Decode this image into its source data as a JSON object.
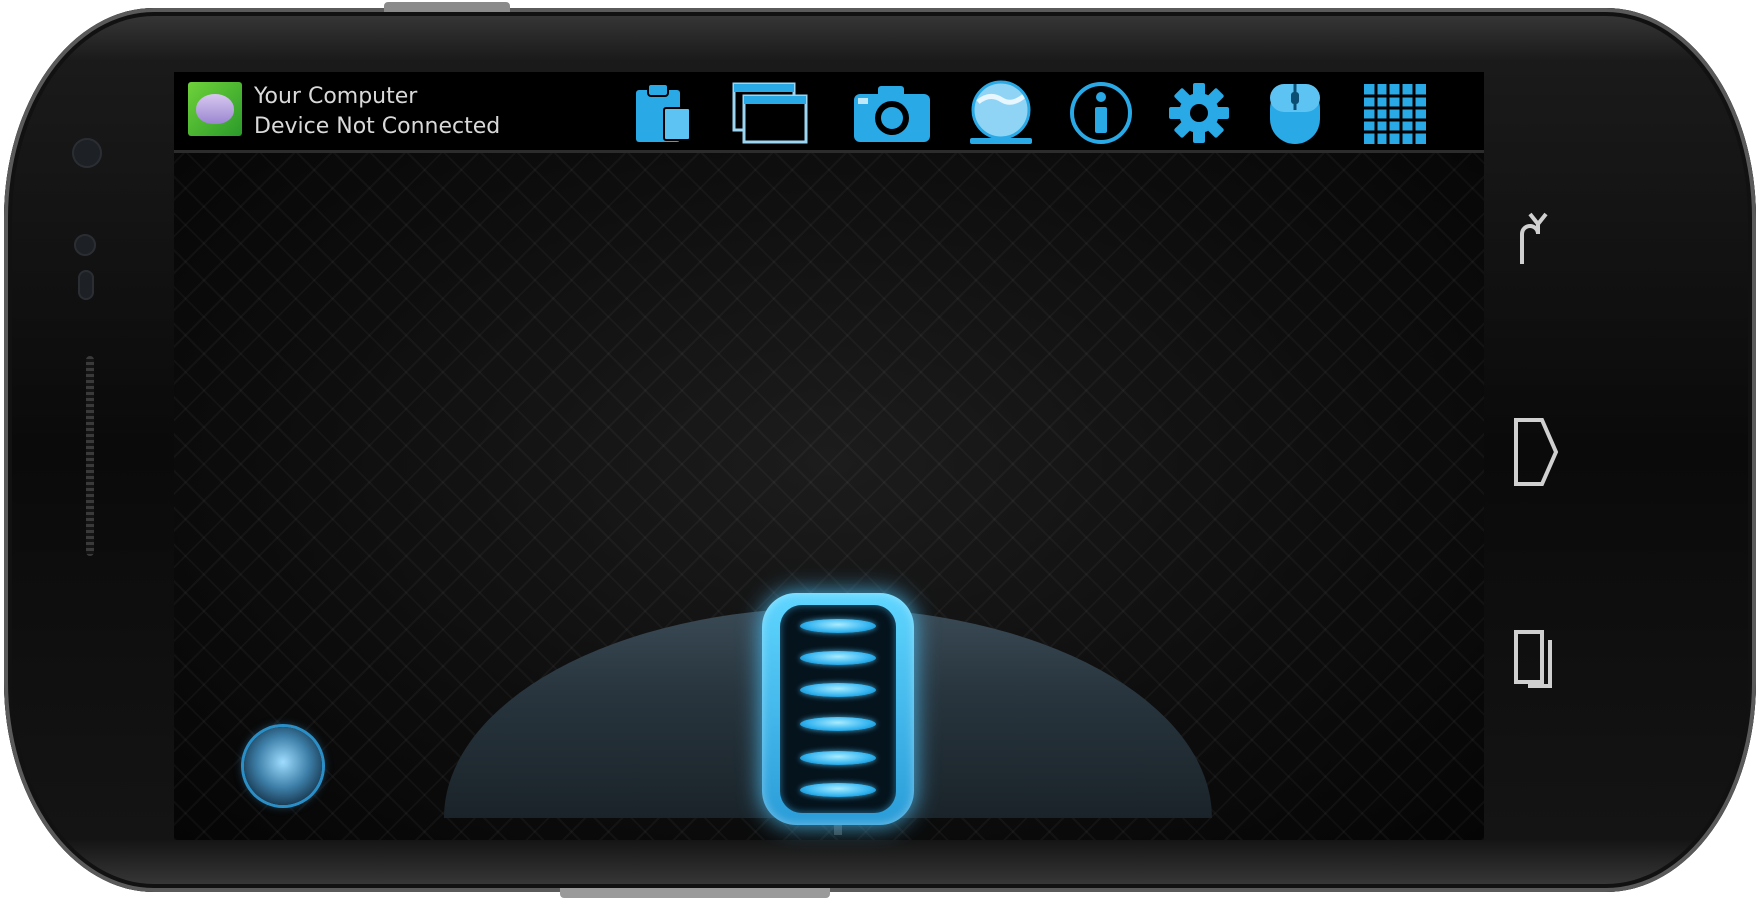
{
  "app": {
    "title": "Your Computer",
    "status": "Device Not Connected"
  },
  "toolbar": {
    "icons": [
      "clipboard-icon",
      "windows-icon",
      "camera-icon",
      "globe-icon",
      "info-icon",
      "gear-icon",
      "mouse-icon",
      "keypad-icon"
    ]
  },
  "android_nav": {
    "buttons": [
      "back-icon",
      "home-icon",
      "recent-apps-icon"
    ]
  },
  "colors": {
    "accent": "#29a9e6",
    "glow": "#5fd6ff",
    "text": "#d9d9d9"
  }
}
